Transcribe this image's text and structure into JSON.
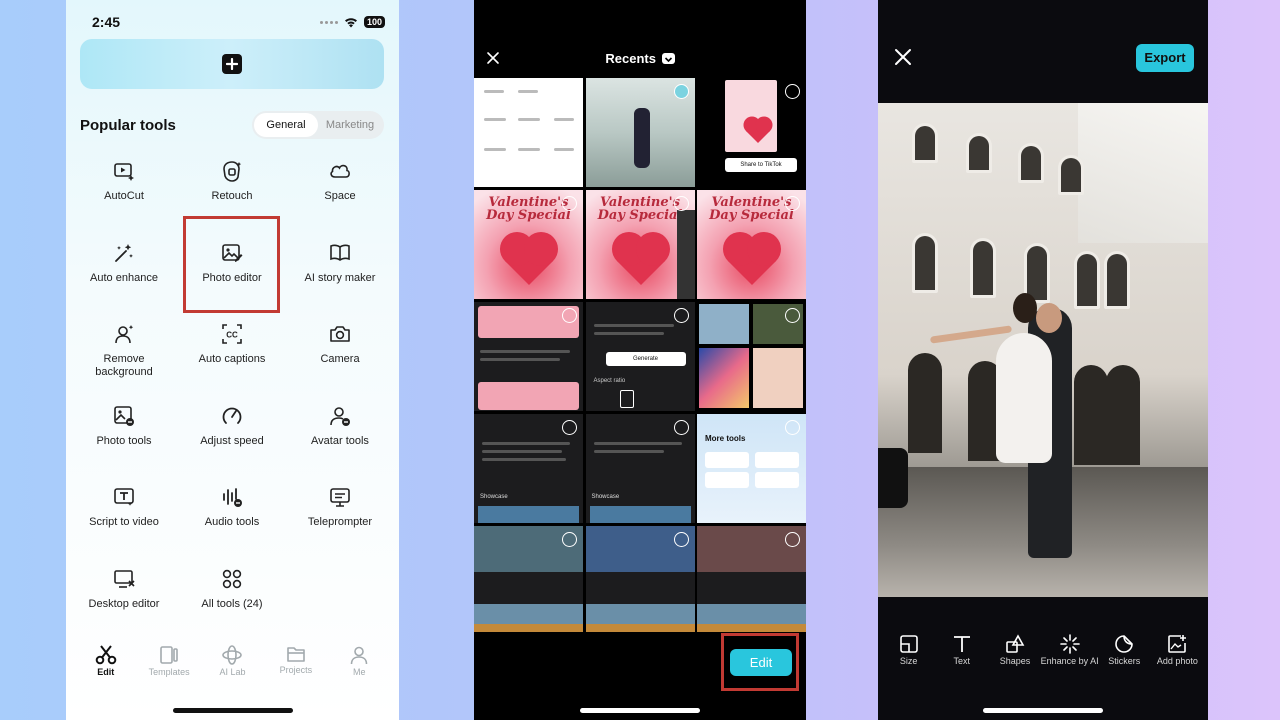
{
  "status_bar": {
    "time": "2:45",
    "battery": "100"
  },
  "screen1": {
    "section_title": "Popular tools",
    "segments": [
      {
        "label": "General",
        "active": true
      },
      {
        "label": "Marketing",
        "active": false
      }
    ],
    "tools": [
      {
        "label": "AutoCut",
        "icon": "autocut-icon"
      },
      {
        "label": "Retouch",
        "icon": "retouch-icon"
      },
      {
        "label": "Space",
        "icon": "cloud-icon"
      },
      {
        "label": "Auto enhance",
        "icon": "magic-wand-icon"
      },
      {
        "label": "Photo editor",
        "icon": "photo-edit-icon"
      },
      {
        "label": "AI story maker",
        "icon": "book-icon"
      },
      {
        "label": "Remove background",
        "icon": "remove-bg-icon"
      },
      {
        "label": "Auto captions",
        "icon": "captions-icon"
      },
      {
        "label": "Camera",
        "icon": "camera-icon"
      },
      {
        "label": "Photo tools",
        "icon": "photo-tools-icon"
      },
      {
        "label": "Adjust speed",
        "icon": "speedometer-icon"
      },
      {
        "label": "Avatar tools",
        "icon": "avatar-icon"
      },
      {
        "label": "Script to video",
        "icon": "script-icon"
      },
      {
        "label": "Audio tools",
        "icon": "audio-icon"
      },
      {
        "label": "Teleprompter",
        "icon": "teleprompter-icon"
      },
      {
        "label": "Desktop editor",
        "icon": "desktop-icon"
      },
      {
        "label": "All tools (24)",
        "icon": "grid-icon"
      }
    ],
    "tabbar": [
      {
        "label": "Edit",
        "active": true
      },
      {
        "label": "Templates",
        "active": false
      },
      {
        "label": "AI Lab",
        "active": false
      },
      {
        "label": "Projects",
        "active": false
      },
      {
        "label": "Me",
        "active": false
      }
    ]
  },
  "screen2": {
    "title": "Recents",
    "edit_label": "Edit",
    "thumb_texts": {
      "valentine": "Valentine's Day Special",
      "share": "Share to TikTok",
      "more_tools": "More tools",
      "showcase": "Showcase",
      "generate": "Generate",
      "aspect_ratio": "Aspect ratio"
    }
  },
  "screen3": {
    "export_label": "Export",
    "tools": [
      {
        "label": "Size",
        "icon": "size-icon"
      },
      {
        "label": "Text",
        "icon": "text-icon"
      },
      {
        "label": "Shapes",
        "icon": "shapes-icon"
      },
      {
        "label": "Enhance by AI",
        "icon": "sparkle-icon"
      },
      {
        "label": "Stickers",
        "icon": "sticker-icon"
      },
      {
        "label": "Add photo",
        "icon": "add-photo-icon"
      }
    ]
  },
  "colors": {
    "accent": "#29c6dd",
    "highlight": "#c23a33"
  }
}
